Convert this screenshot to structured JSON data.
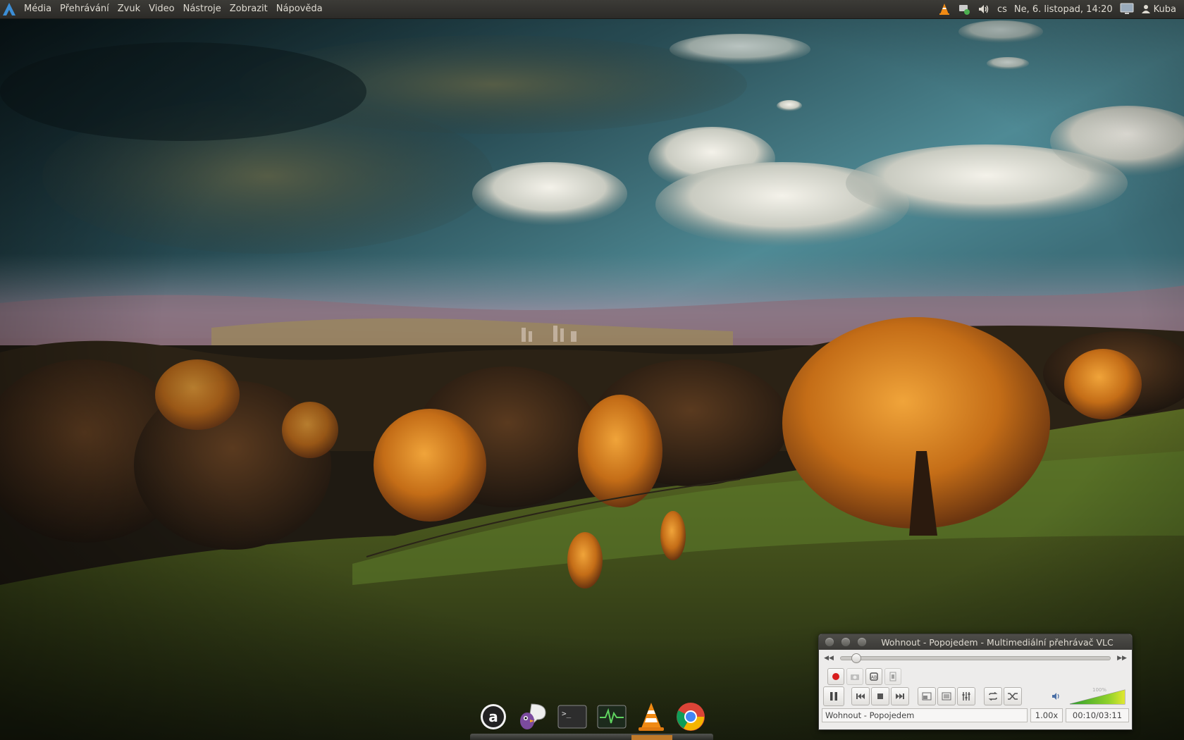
{
  "menubar": {
    "items": [
      "Média",
      "Přehrávání",
      "Zvuk",
      "Video",
      "Nástroje",
      "Zobrazit",
      "Nápověda"
    ]
  },
  "tray": {
    "keyboard_layout": "cs",
    "datetime": "Ne, 6. listopad, 14:20",
    "user": "Kuba"
  },
  "vlc": {
    "title": "Wohnout - Popojedem - Multimediální přehrávač VLC",
    "seek_progress": 0.055,
    "volume_label": "100%",
    "volume_level": 1.0,
    "status": {
      "track": "Wohnout - Popojedem",
      "speed": "1.00x",
      "time": "00:10/03:11"
    }
  },
  "dock": {
    "apps": [
      "AIMP-style a",
      "Pidgin",
      "Terminal",
      "System Monitor",
      "VLC",
      "Chrome"
    ]
  }
}
